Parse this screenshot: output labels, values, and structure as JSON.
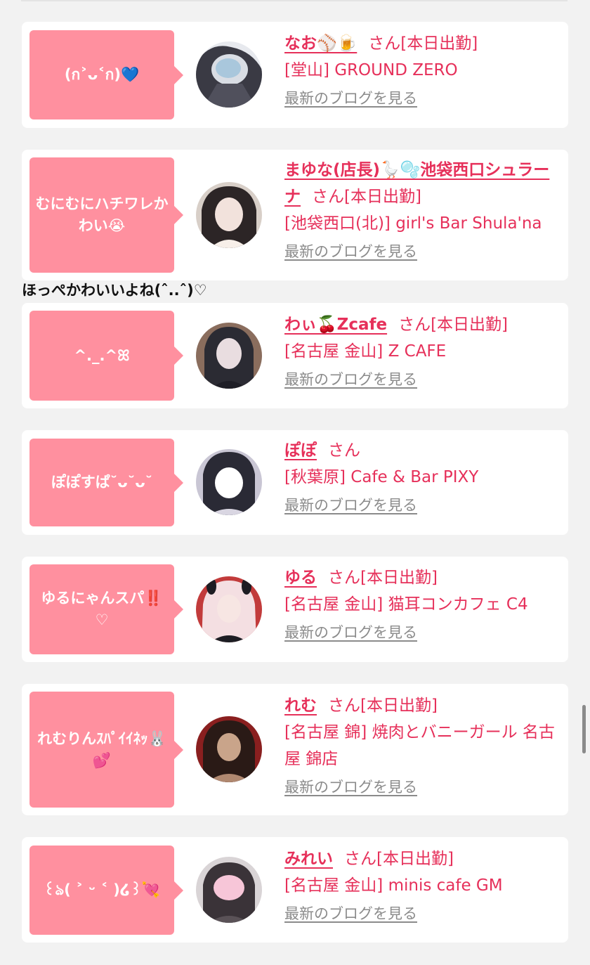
{
  "cards": [
    {
      "message": "(ก˃ᴗ˂ก)💙",
      "name": "なお⚾️🍺",
      "suffix": "さん[本日出勤]",
      "shop": "[堂山] GROUND ZERO",
      "blog_link": "最新のブログを見る",
      "avatar_colors": [
        "#e7e9ee",
        "#3a3a44",
        "#a9c7dc"
      ]
    },
    {
      "message": "むにむにハチワレかわい😭",
      "name": "まゆな(店長)🪿🫧池袋西口シュラーナ",
      "suffix": "さん[本日出勤]",
      "shop": "[池袋西口(北)] girl's Bar Shula'na",
      "blog_link": "最新のブログを見る",
      "avatar_colors": [
        "#d8cfc8",
        "#2c2526",
        "#f2e2dc"
      ]
    },
    {
      "message": "^._.^ꕤ",
      "name": "わぃ🍒Zcafe",
      "suffix": "さん[本日出勤]",
      "shop": "[名古屋 金山] Z CAFE",
      "blog_link": "最新のブログを見る",
      "avatar_colors": [
        "#8a6d5d",
        "#2b2b33",
        "#e9dde0"
      ]
    },
    {
      "message": "ぽぽすぱ˘ᴗ˘ᴗ˘",
      "name": "ぽぽ",
      "suffix": "さん",
      "shop": "[秋葉原] Cafe & Bar PIXY",
      "blog_link": "最新のブログを見る",
      "avatar_colors": [
        "#c9c6d4",
        "#2a2a35",
        "#ffffff"
      ]
    },
    {
      "message": "ゆるにゃんスパ‼️♡",
      "name": "ゆる",
      "suffix": "さん[本日出勤]",
      "shop": "[名古屋 金山] 猫耳コンカフェ C4",
      "blog_link": "最新のブログを見る",
      "avatar_colors": [
        "#c23b3b",
        "#f4dfe2",
        "#1d1d23"
      ]
    },
    {
      "message": "れむりんｽﾊﾟｲｲﾈｯ🐰💕",
      "name": "れむ",
      "suffix": "さん[本日出勤]",
      "shop": "[名古屋 錦] 焼肉とバニーガール 名古屋 錦店",
      "blog_link": "最新のブログを見る",
      "avatar_colors": [
        "#8a1f1f",
        "#2a1a16",
        "#c9a48a"
      ]
    },
    {
      "message": "꒰ঌ( ˃ ᵕ ˂ )໒꒱💘",
      "name": "みれい",
      "suffix": "さん[本日出勤]",
      "shop": "[名古屋 金山] minis cafe GM",
      "blog_link": "最新のブログを見る",
      "avatar_colors": [
        "#d9d4d6",
        "#3a3338",
        "#f7c6d8"
      ]
    }
  ],
  "overflow_text": "ほっぺかわいいよね(ˆ..ˆ)♡"
}
